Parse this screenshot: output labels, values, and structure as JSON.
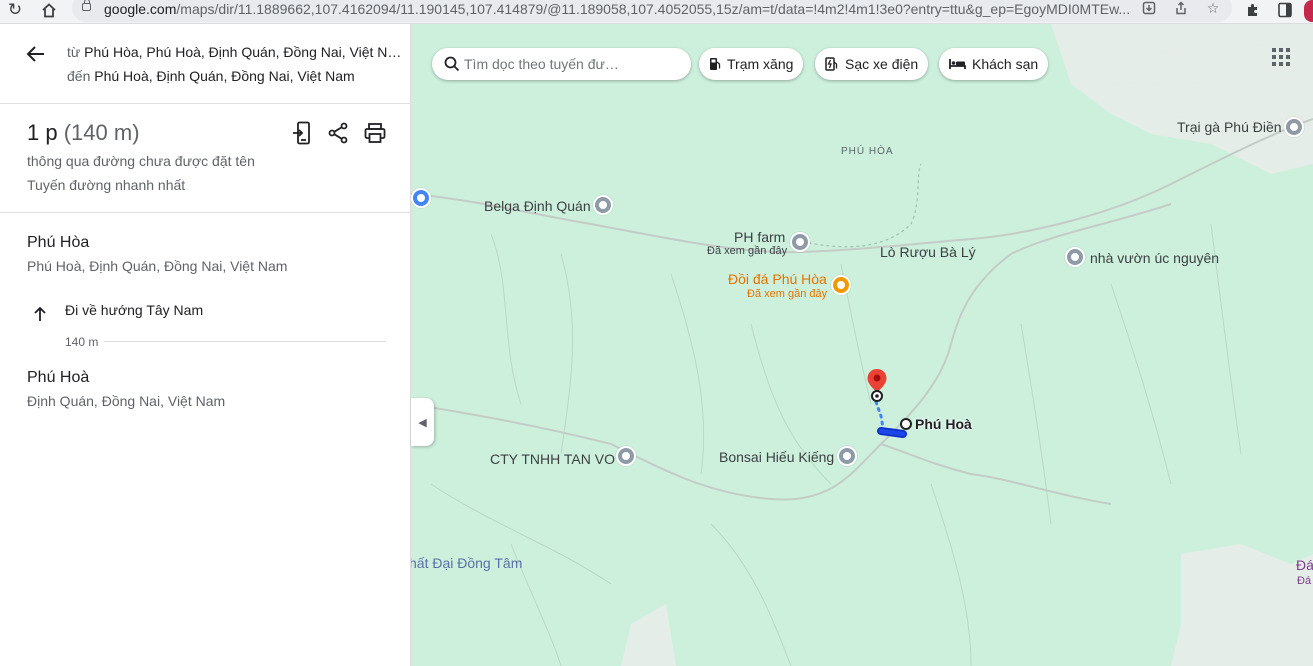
{
  "browser": {
    "url_host": "google.com",
    "url_path": "/maps/dir/11.1889662,107.4162094/11.190145,107.414879/@11.189058,107.4052055,15z/am=t/data=!4m2!4m1!3e0?entry=ttu&g_ep=EgoyMDI0MTEw..."
  },
  "directions": {
    "from_prefix": "từ",
    "from": "Phú Hòa, Phú Hoà, Định Quán, Đồng Nai, Việt N…",
    "to_prefix": "đến",
    "to": "Phú Hoà, Định Quán, Đồng Nai, Việt Nam",
    "duration": "1 p",
    "distance": "(140 m)",
    "via": "thông qua đường chưa được đặt tên",
    "fastest": "Tuyến đường nhanh nhất",
    "start": {
      "name": "Phú Hòa",
      "address": "Phú Hoà, Định Quán, Đồng Nai, Việt Nam"
    },
    "step": {
      "instruction": "Đi về hướng Tây Nam",
      "distance": "140 m"
    },
    "end": {
      "name": "Phú Hoà",
      "address": "Định Quán, Đồng Nai, Việt Nam"
    }
  },
  "map": {
    "search_placeholder": "Tìm dọc theo tuyến đư…",
    "chips": [
      {
        "label": "Trạm xăng",
        "icon": "gas-station-icon"
      },
      {
        "label": "Sạc xe điện",
        "icon": "ev-charger-icon"
      },
      {
        "label": "Khách sạn",
        "icon": "hotel-icon"
      }
    ],
    "places": {
      "trai_ga": "Trại gà Phú Điền",
      "phu_hoa_area": "PHÚ HÒA",
      "belga": "Belga Định Quán",
      "ph_farm": "PH farm",
      "ph_farm_sub": "Đã xem gần đây",
      "lo_ruou": "Lò Rượu Bà Lý",
      "nha_vuon": "nhà vườn úc nguyên",
      "doi_da": "Đồi đá Phú Hòa",
      "doi_da_sub": "Đã xem gần đây",
      "dest": "Phú Hoà",
      "cty": "CTY TNHH TAN VO",
      "bonsai": "Bonsai Hiếu Kiếng",
      "dai_dong_tam": "hất Đại Đồng Tâm",
      "edge1": "Đá",
      "edge2": "Đá"
    },
    "colors": {
      "land": "#cdf0dd",
      "road": "#bfc9c3",
      "route": "#1a47e6",
      "pin": "#ea4335"
    }
  }
}
